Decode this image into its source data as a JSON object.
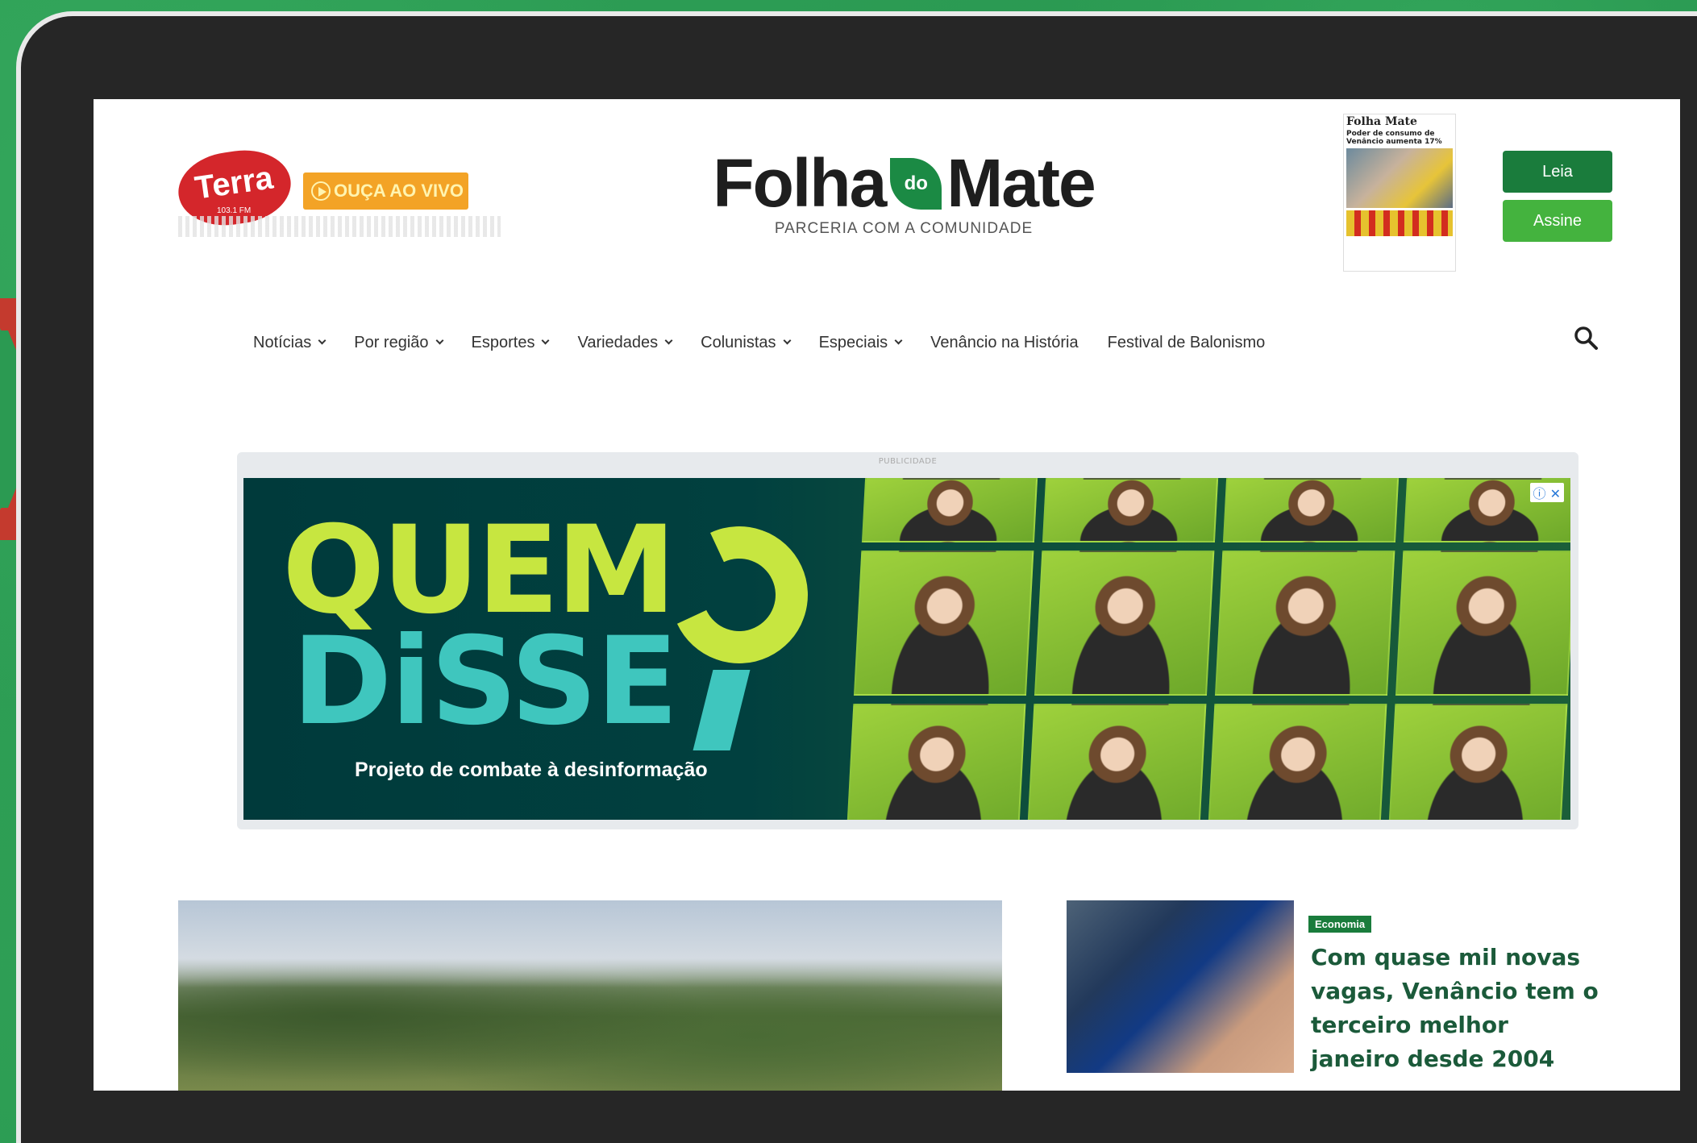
{
  "radio": {
    "logo_text": "Terra",
    "logo_sub": "103.1 FM",
    "listen_live_label": "OUÇA AO VIVO"
  },
  "brand": {
    "name_part1": "Folha",
    "name_leaf": "do",
    "name_part2": "Mate",
    "tagline": "PARCERIA COM A COMUNIDADE"
  },
  "newspaper": {
    "title": "Folha Mate",
    "headline": "Poder de consumo de Venâncio aumenta 17%"
  },
  "actions": {
    "read_label": "Leia",
    "subscribe_label": "Assine"
  },
  "nav": {
    "items": [
      {
        "label": "Notícias",
        "dropdown": true
      },
      {
        "label": "Por região",
        "dropdown": true
      },
      {
        "label": "Esportes",
        "dropdown": true
      },
      {
        "label": "Variedades",
        "dropdown": true
      },
      {
        "label": "Colunistas",
        "dropdown": true
      },
      {
        "label": "Especiais",
        "dropdown": true
      },
      {
        "label": "Venâncio na História",
        "dropdown": false
      },
      {
        "label": "Festival de Balonismo",
        "dropdown": false
      }
    ],
    "search_icon": "search-icon"
  },
  "ad": {
    "label": "PUBLICIDADE",
    "line1": "QUEM",
    "line2": "DiSSE",
    "subtitle": "Projeto de combate à desinformação",
    "close_label": "ⓘ ✕"
  },
  "story": {
    "category": "Economia",
    "headline": "Com quase mil novas vagas, Venâncio tem o terceiro melhor janeiro desde 2004"
  },
  "colors": {
    "brand_green": "#1a7c3c",
    "accent_green": "#44b33e",
    "background_green": "#2b9a52",
    "radio_red": "#d4262b",
    "listen_orange": "#f3a326",
    "arrow_red": "#c43a2e"
  }
}
